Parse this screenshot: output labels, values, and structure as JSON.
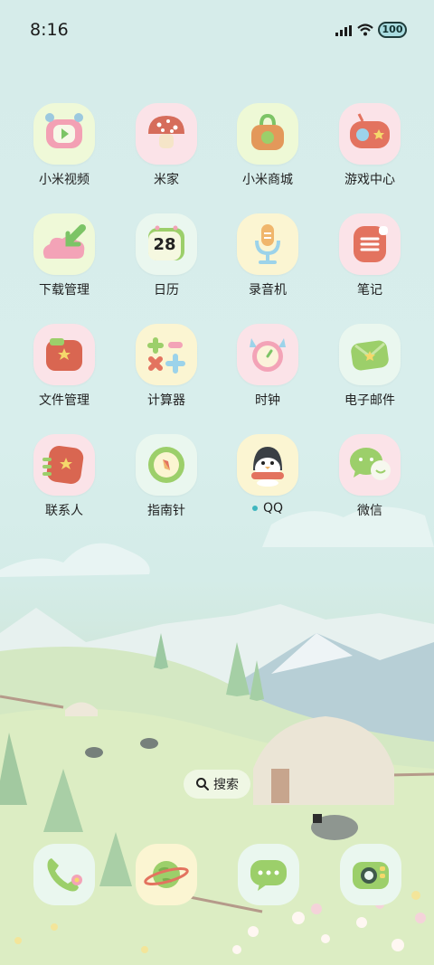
{
  "status_bar": {
    "time": "8:16",
    "battery": "100",
    "icons": [
      "signal-icon",
      "wifi-icon",
      "battery-icon"
    ]
  },
  "apps": [
    {
      "label": "小米视频",
      "icon": "video-icon"
    },
    {
      "label": "米家",
      "icon": "mushroom-icon"
    },
    {
      "label": "小米商城",
      "icon": "shopping-bag-icon"
    },
    {
      "label": "游戏中心",
      "icon": "gamepad-icon"
    },
    {
      "label": "下载管理",
      "icon": "download-cloud-icon"
    },
    {
      "label": "日历",
      "icon": "calendar-icon",
      "date": "28"
    },
    {
      "label": "录音机",
      "icon": "microphone-icon"
    },
    {
      "label": "笔记",
      "icon": "notes-icon"
    },
    {
      "label": "文件管理",
      "icon": "folder-icon"
    },
    {
      "label": "计算器",
      "icon": "calculator-icon"
    },
    {
      "label": "时钟",
      "icon": "alarm-clock-icon"
    },
    {
      "label": "电子邮件",
      "icon": "envelope-icon"
    },
    {
      "label": "联系人",
      "icon": "contacts-icon"
    },
    {
      "label": "指南针",
      "icon": "compass-icon"
    },
    {
      "label": "QQ",
      "icon": "penguin-icon",
      "badge": "new-dot"
    },
    {
      "label": "微信",
      "icon": "wechat-icon"
    }
  ],
  "search": {
    "label": "搜索",
    "icon": "search-icon"
  },
  "dock": [
    {
      "icon": "phone-icon"
    },
    {
      "icon": "browser-planet-icon"
    },
    {
      "icon": "message-icon"
    },
    {
      "icon": "camera-icon"
    }
  ],
  "colors": {
    "sky": "#d6ecea",
    "tile_pink": "#fbe3e8",
    "tile_yellow": "#fbf5d2",
    "tile_mint": "#eaf7ef",
    "accent_red": "#e3735f",
    "accent_green": "#9ccf6a",
    "accent_blue": "#9cd3ea"
  }
}
